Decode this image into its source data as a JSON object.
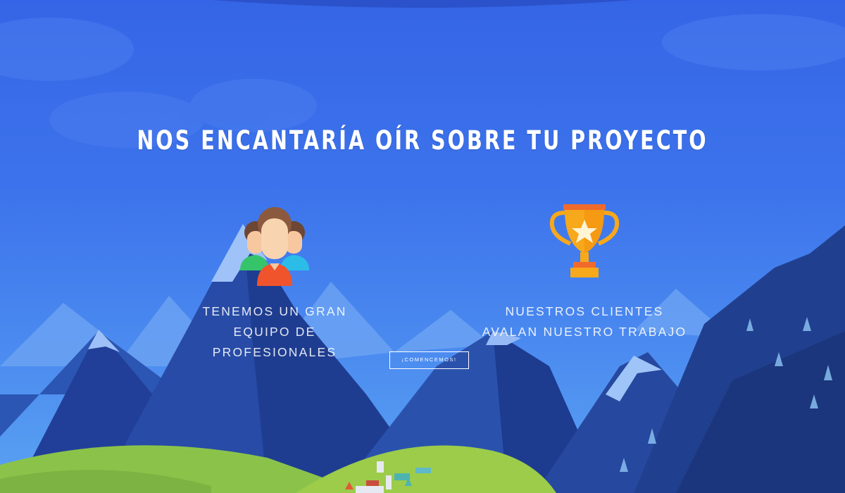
{
  "hero": {
    "headline": "NOS ENCANTARÍA OÍR SOBRE TU PROYECTO",
    "cta_label": "¡COMENCEMOS!",
    "features": [
      {
        "icon": "team-people-icon",
        "line1": "TENEMOS UN GRAN",
        "line2": "EQUIPO DE PROFESIONALES"
      },
      {
        "icon": "trophy-star-icon",
        "line1": "NUESTROS CLIENTES",
        "line2": "AVALAN NUESTRO TRABAJO"
      }
    ]
  },
  "colors": {
    "sky_top": "#3565e6",
    "sky_bottom": "#5aa3f2",
    "mountain_dark": "#1e3a8c",
    "mountain_mid": "#2a4fa8",
    "snow": "#8fb3f5",
    "grass": "#8ec23f",
    "person_shirt": "#f0542c",
    "trophy_gold": "#f7a81b"
  }
}
